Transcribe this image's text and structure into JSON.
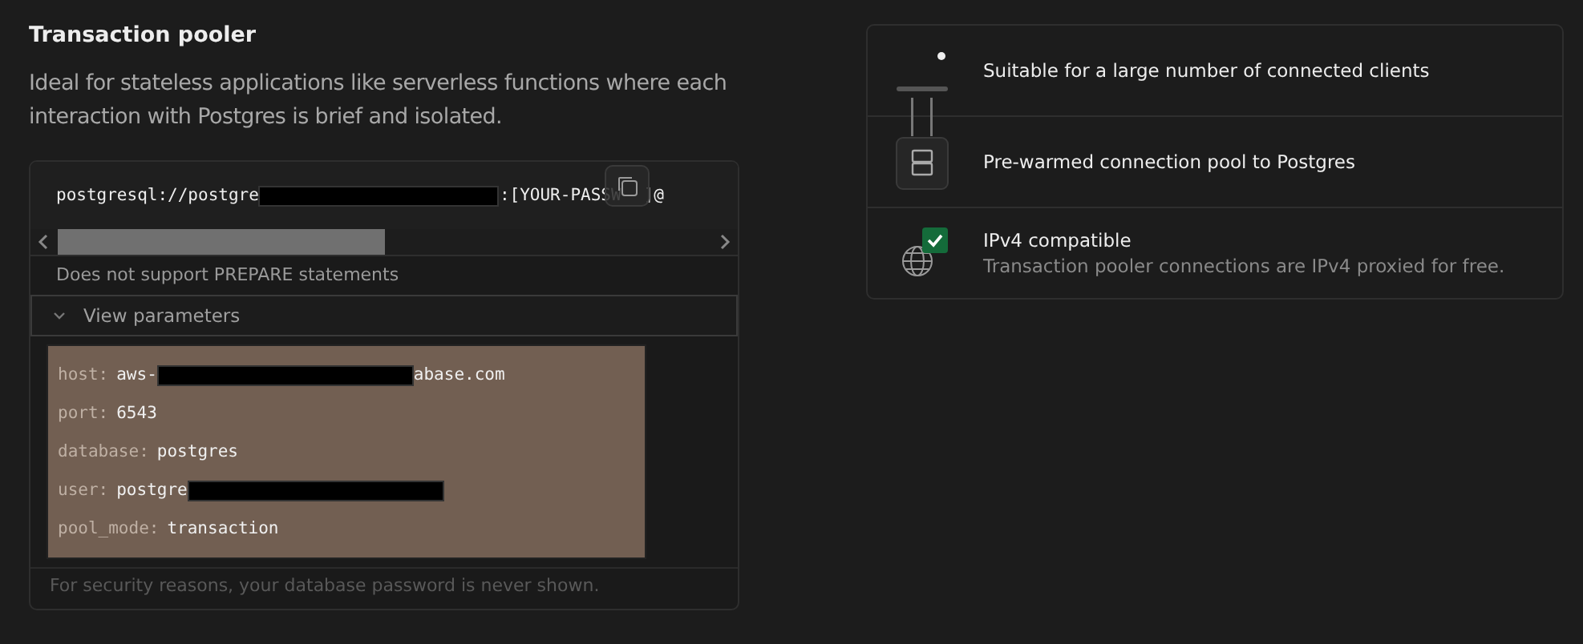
{
  "section": {
    "title": "Transaction pooler",
    "description": "Ideal for stateless applications like serverless functions where each interaction with Postgres is brief and isolated."
  },
  "connection": {
    "prefix": "postgresql://postgre",
    "redacted": true,
    "middle": ":[YOUR-PASSW",
    "suffix": "]@",
    "note": "Does not support PREPARE statements",
    "toggle": {
      "label": "View parameters",
      "expanded": true
    },
    "parameters": [
      {
        "key": "host:",
        "value": "aws-",
        "redacted": true,
        "value_end": "abase.com"
      },
      {
        "key": "port:",
        "value": "6543",
        "redacted": false
      },
      {
        "key": "database:",
        "value": "postgres",
        "redacted": false
      },
      {
        "key": "user:",
        "value": "postgre",
        "redacted": true
      },
      {
        "key": "pool_mode:",
        "value": "transaction",
        "redacted": false
      }
    ],
    "footer": "For security reasons, your database password is never shown."
  },
  "features": [
    {
      "kind": "clients",
      "title": "Suitable for a large number of connected clients"
    },
    {
      "kind": "pool",
      "title": "Pre-warmed connection pool to Postgres"
    },
    {
      "kind": "ipv4",
      "title": "IPv4 compatible",
      "description": "Transaction pooler connections are IPv4 proxied for free."
    }
  ]
}
